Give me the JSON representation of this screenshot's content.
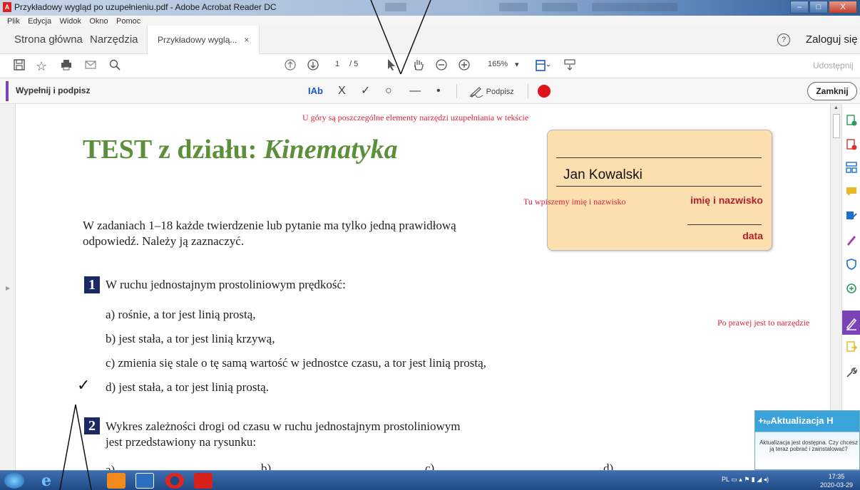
{
  "window": {
    "title": "Przykładowy wygląd po uzupełnieniu.pdf - Adobe Acrobat Reader DC",
    "pdf_mark": "A",
    "minimize": "–",
    "maximize": "□",
    "close": "X"
  },
  "menu": [
    "Plik",
    "Edycja",
    "Widok",
    "Okno",
    "Pomoc"
  ],
  "tabs": {
    "home": "Strona główna",
    "tools": "Narzędzia",
    "document": "Przykładowy wyglą...",
    "close_glyph": "×",
    "help_glyph": "?",
    "login": "Zaloguj się"
  },
  "toolbar": {
    "page_current": "1",
    "page_total": "/ 5",
    "zoom": "165%",
    "share": "Udostępnij"
  },
  "fill_sign": {
    "label": "Wypełnij i podpisz",
    "text_tool": "Ab",
    "cross": "X",
    "check": "✓",
    "circle": "○",
    "line": "—",
    "dot": "•",
    "sign": "Podpisz",
    "close": "Zamknij"
  },
  "annotations": {
    "top": "U góry są poszczególne elementy  narzędzi uzupełniania w tekście",
    "name_hint": "Tu wpiszemy imię i nazwisko",
    "right_hint": "Po prawej jest to narzędzie"
  },
  "document": {
    "title_plain": "TEST z działu: ",
    "title_italic": "Kinematyka",
    "intro": "W zadaniach 1–18  każde twierdzenie lub pytanie ma tylko jedną prawidłową odpowiedź. Należy ją zaznaczyć.",
    "q1": {
      "number": "1",
      "text": "W ruchu jednostajnym prostoliniowym prędkość:",
      "answers": [
        "a)  rośnie, a tor jest linią prostą,",
        "b)  jest stała, a tor jest linią krzywą,",
        "c)  zmienia się stale o tę samą wartość w jednostce czasu, a tor jest linią prostą,",
        "d)  jest stała, a tor jest linią prostą."
      ],
      "checkmark": "✓"
    },
    "q2": {
      "number": "2",
      "text_line1": "Wykres zależności drogi od czasu w ruchu jednostajnym prostoliniowym",
      "text_line2": "jest przedstawiony na rysunku:",
      "options": [
        "a)",
        "b)",
        "c)",
        "d)"
      ]
    }
  },
  "name_card": {
    "name": "Jan Kowalski",
    "name_label": "imię i nazwisko",
    "date_label": "data"
  },
  "hp_popup": {
    "title": "Aktualizacja H",
    "body": "Aktualizacja jest dostępna. Czy chcesz ją teraz pobrać i zainstalować?"
  },
  "taskbar": {
    "lang": "PL",
    "time": "17:35",
    "date": "2020-03-29"
  },
  "colors": {
    "title_green": "#5c8f3a",
    "annotation_red": "#e0203b",
    "accent_purple": "#7a43b6",
    "card_bg": "#fbdfae"
  }
}
